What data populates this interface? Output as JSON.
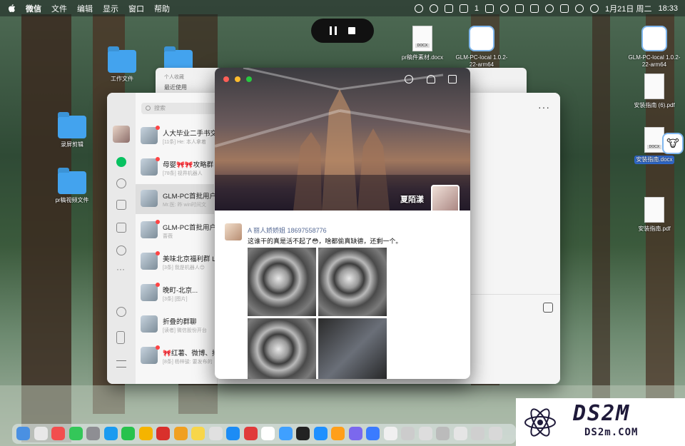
{
  "menubar": {
    "app_name": "微信",
    "menus": [
      "文件",
      "编辑",
      "显示",
      "窗口",
      "帮助"
    ],
    "badge_count": "1",
    "date": "1月21日 周二",
    "time": "18:33"
  },
  "desktop": {
    "items": [
      {
        "label": "工作文件"
      },
      {
        "label": "录屏剪辑"
      },
      {
        "label": "pr稿视频文件"
      },
      {
        "label": "pr稿件素材.docx"
      },
      {
        "label": "GLM-PC-local\n1.0.2-22-arm64"
      },
      {
        "label": "GLM-PC-local\n1.0.2-22-arm64"
      },
      {
        "label": "安装指南 (6).pdf"
      },
      {
        "label": "安装指南.docx"
      },
      {
        "label": "安装指南.pdf"
      }
    ],
    "docx_tag": "DOCX"
  },
  "finder_back": {
    "line1": "个人收藏",
    "line2": "最近使用"
  },
  "wechat": {
    "search_placeholder": "搜索",
    "chats": [
      {
        "name": "人大毕业二手书交",
        "sub": "[11条] He: 本人拿着",
        "unread": true
      },
      {
        "name": "母婴🎀🎀攻略群",
        "sub": "[78条] 视界机器人",
        "unread": true
      },
      {
        "name": "GLM-PC首批用户",
        "sub": "Mr.医: 昨 win时间文",
        "unread": false
      },
      {
        "name": "GLM-PC首批用户",
        "sub": "蔷薇",
        "unread": true
      },
      {
        "name": "美味北京福利群 L4",
        "sub": "[3条] 我是机器人😊",
        "unread": true
      },
      {
        "name": "晚町-北京...",
        "sub": "[3条] [图片]",
        "unread": true
      },
      {
        "name": "折叠的群聊",
        "sub": "[读者] 微信股份开台",
        "unread": false
      },
      {
        "name": "🎀红薯、微博、抖",
        "sub": "[8条] 杨梓骏: 要发布的",
        "unread": true
      }
    ],
    "more_label": "···"
  },
  "moments": {
    "cover_name": "夏陌漾",
    "post": {
      "author": "A 丽人娇娇姐",
      "phone": "18697558776",
      "text": "这谁干的真是活不起了😳，啥都偷真缺德，还剩一个。"
    }
  },
  "watermark": {
    "big": "DS2M",
    "small": "DS2m.COM"
  },
  "colors": {
    "wechat_green": "#07c160",
    "link_blue": "#576b95",
    "unread_red": "#ff4444",
    "folder_blue": "#43a3ee"
  }
}
